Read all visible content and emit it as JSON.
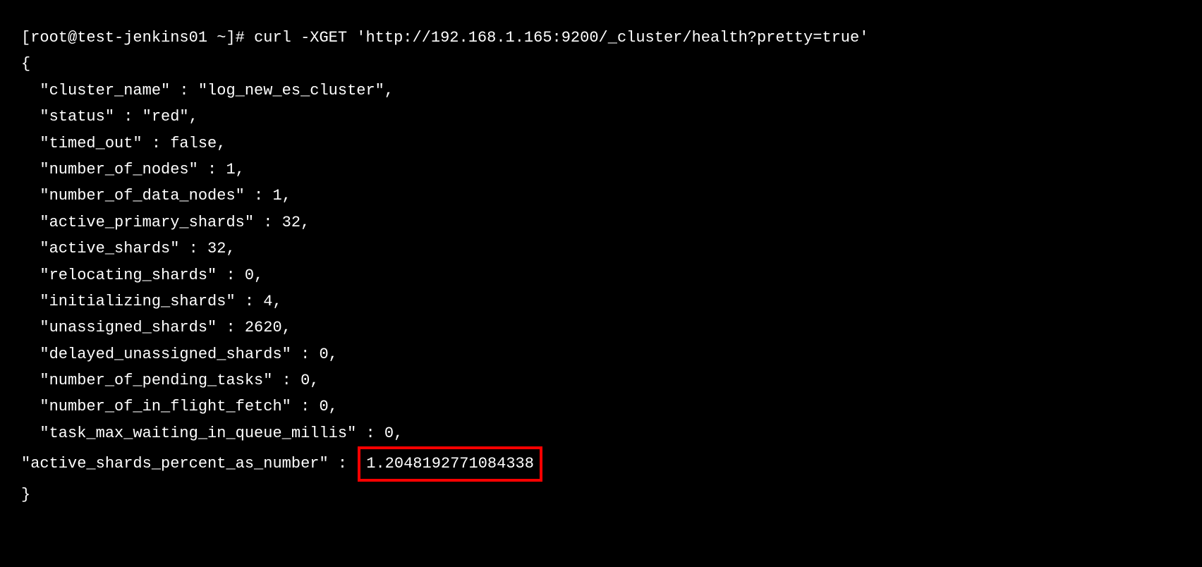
{
  "prompt": "[root@test-jenkins01 ~]# ",
  "command": "curl -XGET 'http://192.168.1.165:9200/_cluster/health?pretty=true'",
  "json_open": "{",
  "json_close": "}",
  "lines": {
    "cluster_name": "  \"cluster_name\" : \"log_new_es_cluster\",",
    "status": "  \"status\" : \"red\",",
    "timed_out": "  \"timed_out\" : false,",
    "number_of_nodes": "  \"number_of_nodes\" : 1,",
    "number_of_data_nodes": "  \"number_of_data_nodes\" : 1,",
    "active_primary_shards": "  \"active_primary_shards\" : 32,",
    "active_shards": "  \"active_shards\" : 32,",
    "relocating_shards": "  \"relocating_shards\" : 0,",
    "initializing_shards": "  \"initializing_shards\" : 4,",
    "unassigned_shards": "  \"unassigned_shards\" : 2620,",
    "delayed_unassigned_shards": "  \"delayed_unassigned_shards\" : 0,",
    "number_of_pending_tasks": "  \"number_of_pending_tasks\" : 0,",
    "number_of_in_flight_fetch": "  \"number_of_in_flight_fetch\" : 0,",
    "task_max_waiting_in_queue_millis": "  \"task_max_waiting_in_queue_millis\" : 0,",
    "active_shards_percent_label": "  \"active_shards_percent_as_number\" : ",
    "active_shards_percent_value": "1.2048192771084338"
  }
}
